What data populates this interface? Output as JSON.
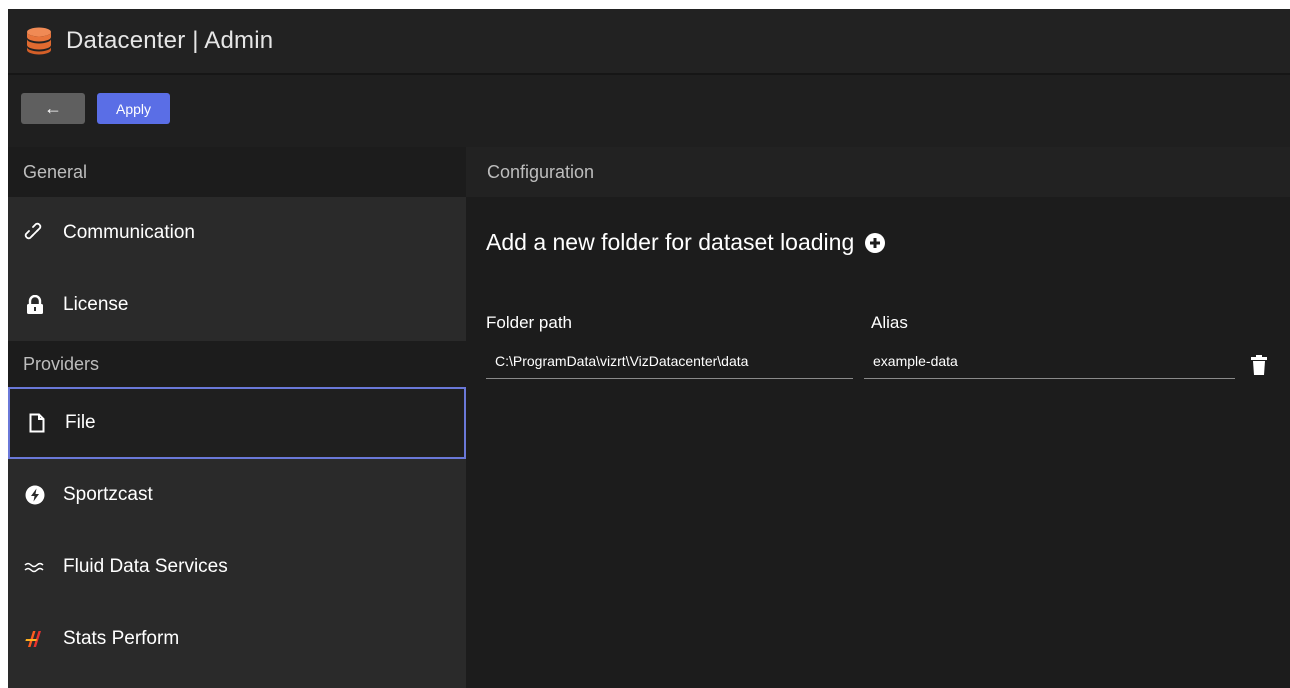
{
  "app": {
    "title": "Datacenter | Admin"
  },
  "toolbar": {
    "back_icon": "←",
    "apply_label": "Apply"
  },
  "sidebar": {
    "general_header": "General",
    "providers_header": "Providers",
    "items": [
      {
        "label": "Communication",
        "icon": "link-icon"
      },
      {
        "label": "License",
        "icon": "lock-icon"
      },
      {
        "label": "File",
        "icon": "file-icon",
        "selected": true
      },
      {
        "label": "Sportzcast",
        "icon": "bolt-icon"
      },
      {
        "label": "Fluid Data Services",
        "icon": "waves-icon"
      },
      {
        "label": "Stats Perform",
        "icon": "stats-perform-logo-icon"
      }
    ]
  },
  "main": {
    "header": "Configuration",
    "add_folder_label": "Add a new folder for dataset loading",
    "columns": {
      "folder_path": "Folder path",
      "alias": "Alias"
    },
    "rows": [
      {
        "folder_path": "C:\\ProgramData\\vizrt\\VizDatacenter\\data",
        "alias": "example-data"
      }
    ]
  },
  "colors": {
    "accent": "#5a6ee6",
    "selection_border": "#6a78d8",
    "logo": "#e8743b"
  }
}
